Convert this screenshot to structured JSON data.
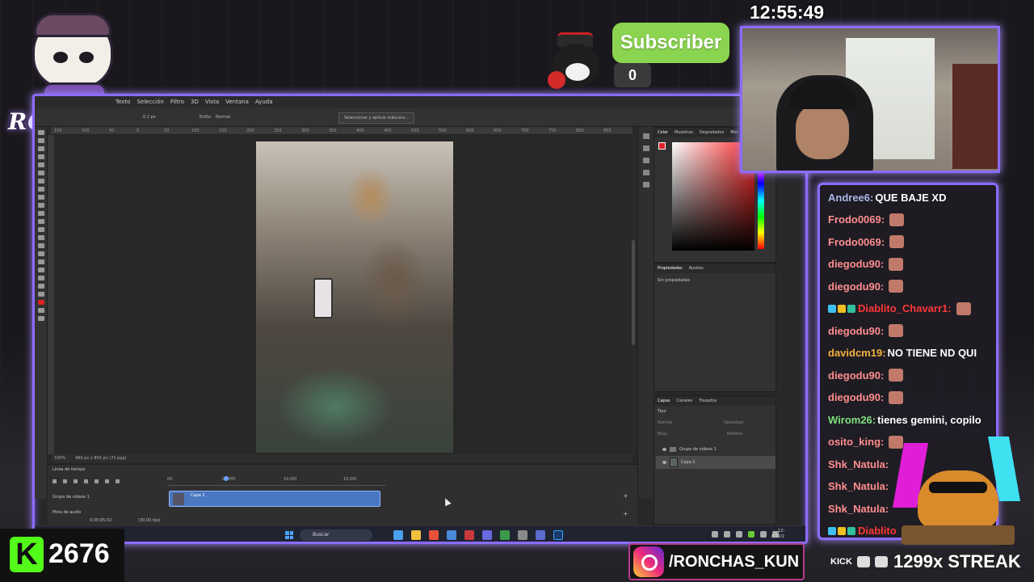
{
  "overlay": {
    "logo_text": "RONCHAS",
    "subscriber_label": "Subscriber",
    "subscriber_count": "0",
    "clock": "12:55:49",
    "kick_count": "2676",
    "kick_letter": "K",
    "instagram_handle": "/RONCHAS_KUN",
    "socials_kick": "KICK",
    "streak": "1299x STREAK"
  },
  "photoshop": {
    "menu": [
      "Texto",
      "Selección",
      "Filtro",
      "3D",
      "Vista",
      "Ventana",
      "Ayuda"
    ],
    "options": {
      "feather_value": "0.2 px",
      "style_label": "Estilo:",
      "style_value": "Normal",
      "select_mask_button": "Seleccionar y aplicar máscara..."
    },
    "ruler_ticks": [
      "150",
      "100",
      "50",
      "0",
      "50",
      "100",
      "150",
      "200",
      "250",
      "300",
      "350",
      "400",
      "450",
      "500",
      "550",
      "600",
      "650",
      "700",
      "750",
      "800",
      "850"
    ],
    "status": {
      "zoom": "100%",
      "doc_info": "480 px x 854 px (72 ppp)"
    },
    "color_panel_tabs": [
      "Color",
      "Muestras",
      "Degradados",
      "Mot"
    ],
    "properties_tabs": [
      "Propiedades",
      "Ajustes"
    ],
    "properties_empty": "Sin propiedades",
    "layers_tabs": [
      "Capas",
      "Canales",
      "Trazados"
    ],
    "layers_filter": "Tipo",
    "layers_blend": "Normal",
    "layers_opacity_label": "Opacidad:",
    "layers_fill_label": "Relleno:",
    "layers_lock_label": "Bloq.:",
    "layer_group": "Grupo de vídeos 1",
    "layer_item": "Capa 1",
    "timeline": {
      "title": "Línea de tiempo",
      "ticks": [
        "00",
        "05:00f",
        "10:00f",
        "15:00f"
      ],
      "track_label": "Grupo de vídeos 1",
      "clip_label": "Capa 1",
      "audio_label": "Pista de audio",
      "time": "0:00:05:02",
      "fps": "(30,00 fps)"
    },
    "taskbar": {
      "search_label": "Buscar",
      "clock_time": "12:",
      "clock_date": "8/12/2"
    }
  },
  "chat": [
    {
      "user": "Andree6:",
      "msg": "QUE BAJE XD",
      "color": "#a9b8e8",
      "emote": false,
      "badges": false
    },
    {
      "user": "Frodo0069:",
      "msg": "",
      "color": "#ff8e8e",
      "emote": true,
      "badges": false
    },
    {
      "user": "Frodo0069:",
      "msg": "",
      "color": "#ff8e8e",
      "emote": true,
      "badges": false
    },
    {
      "user": "diegodu90:",
      "msg": "",
      "color": "#ff8e8e",
      "emote": true,
      "badges": false
    },
    {
      "user": "diegodu90:",
      "msg": "",
      "color": "#ff8e8e",
      "emote": true,
      "badges": false
    },
    {
      "user": "Diablito_Chavarr1:",
      "msg": "",
      "color": "#ff3838",
      "emote": true,
      "badges": true
    },
    {
      "user": "diegodu90:",
      "msg": "",
      "color": "#ff8e8e",
      "emote": true,
      "badges": false
    },
    {
      "user": "davidcm19:",
      "msg": "NO TIENE ND QUI",
      "color": "#f5b041",
      "emote": false,
      "badges": false
    },
    {
      "user": "diegodu90:",
      "msg": "",
      "color": "#ff8e8e",
      "emote": true,
      "badges": false
    },
    {
      "user": "diegodu90:",
      "msg": "",
      "color": "#ff8e8e",
      "emote": true,
      "badges": false
    },
    {
      "user": "Wirom26:",
      "msg": "tienes gemini, copilo",
      "color": "#7ee07e",
      "emote": false,
      "badges": false
    },
    {
      "user": "osito_king:",
      "msg": "",
      "color": "#ff8e8e",
      "emote": true,
      "badges": false
    },
    {
      "user": "Shk_Natula:",
      "msg": "",
      "color": "#ff8e8e",
      "emote": false,
      "badges": false
    },
    {
      "user": "Shk_Natula:",
      "msg": "",
      "color": "#ff8e8e",
      "emote": false,
      "badges": false
    },
    {
      "user": "Shk_Natula:",
      "msg": "",
      "color": "#ff8e8e",
      "emote": false,
      "badges": false
    },
    {
      "user": "Diablito",
      "msg": "",
      "color": "#ff3838",
      "emote": false,
      "badges": true
    }
  ],
  "colors": {
    "frame_accent": "#8b6cff",
    "kick_green": "#53fc18",
    "subscriber_green": "#8bd450"
  }
}
